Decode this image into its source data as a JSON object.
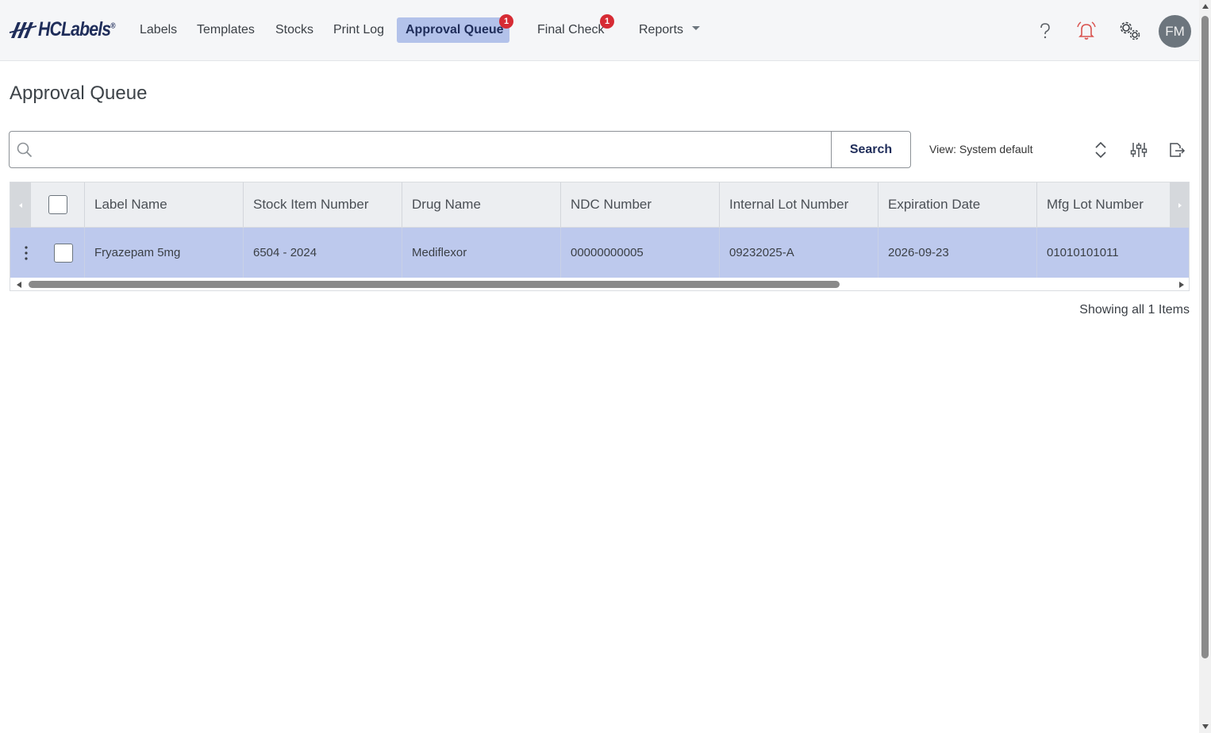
{
  "app": {
    "logo_text": "HCLabels",
    "logo_reg": "®"
  },
  "nav": {
    "items": [
      {
        "label": "Labels"
      },
      {
        "label": "Templates"
      },
      {
        "label": "Stocks"
      },
      {
        "label": "Print Log"
      },
      {
        "label": "Approval Queue",
        "badge": "1",
        "active": true
      },
      {
        "label": "Final Check",
        "badge": "1"
      },
      {
        "label": "Reports"
      }
    ],
    "icons": [
      "help-icon",
      "bell-icon",
      "settings-gears-icon"
    ],
    "avatar_initials": "FM"
  },
  "page": {
    "title": "Approval Queue"
  },
  "search": {
    "value": "",
    "placeholder": "",
    "button_label": "Search"
  },
  "toolbar": {
    "view_label": "View: System default",
    "icons": [
      "expand-collapse-icon",
      "column-settings-icon",
      "export-icon"
    ]
  },
  "table": {
    "columns": [
      "Label Name",
      "Stock Item Number",
      "Drug Name",
      "NDC Number",
      "Internal Lot Number",
      "Expiration Date",
      "Mfg Lot Number"
    ],
    "rows": [
      [
        "Fryazepam 5mg",
        "6504 - 2024",
        "Mediflexor",
        "00000000005",
        "09232025-A",
        "2026-09-23",
        "01010101011"
      ]
    ],
    "selected_row_color": "#bdc9ed"
  },
  "footer": {
    "count_text": "Showing all 1 Items"
  },
  "colors": {
    "brand_navy": "#1f2d5a",
    "active_nav": "#b3c2ea",
    "badge_red": "#d62b34",
    "bell_red": "#d9534f"
  }
}
